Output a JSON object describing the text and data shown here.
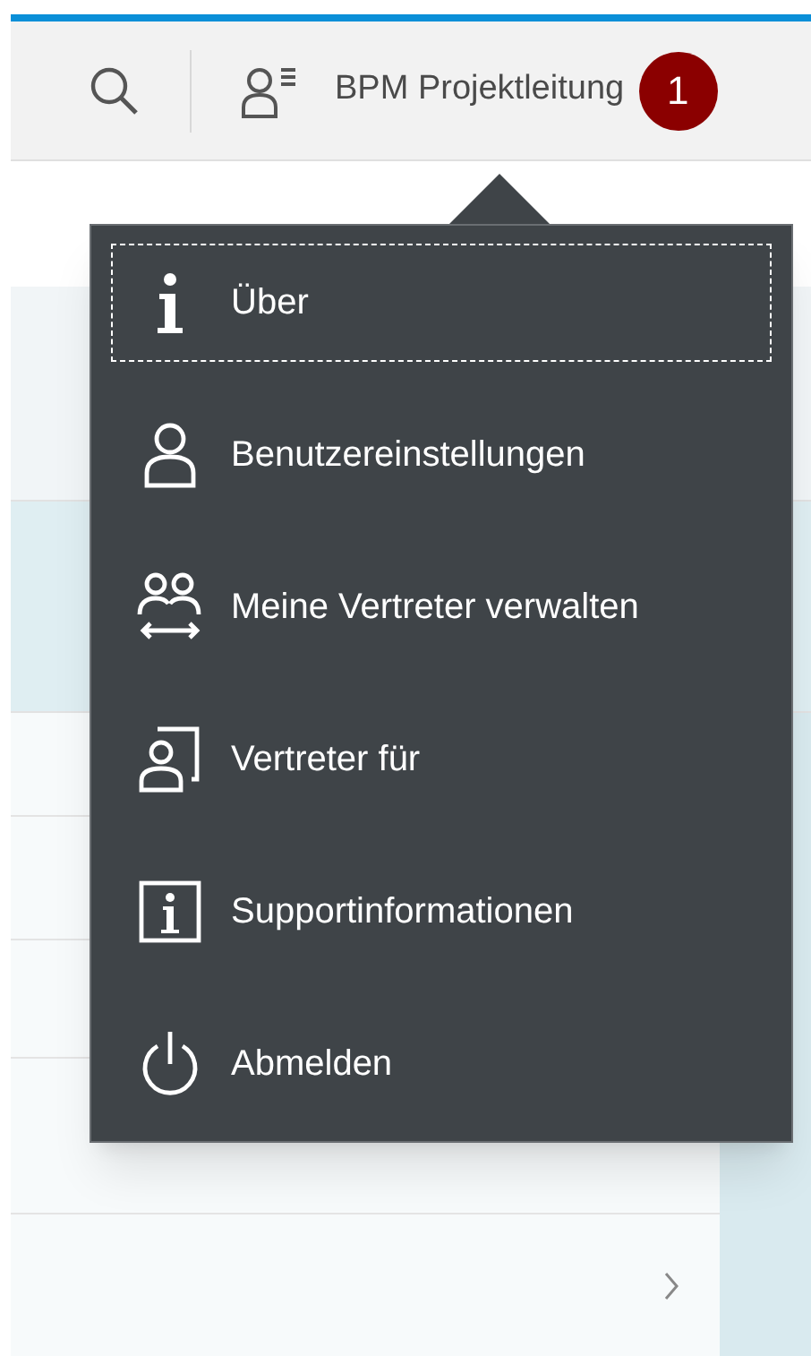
{
  "header": {
    "user_name": "BPM Projektleitung",
    "notification_count": "1"
  },
  "user_menu": {
    "items": [
      {
        "label": "Über",
        "focused": true
      },
      {
        "label": "Benutzereinstellungen",
        "focused": false
      },
      {
        "label": "Meine Vertreter verwalten",
        "focused": false
      },
      {
        "label": "Vertreter für",
        "focused": false
      },
      {
        "label": "Supportinformationen",
        "focused": false
      },
      {
        "label": "Abmelden",
        "focused": false
      }
    ]
  }
}
